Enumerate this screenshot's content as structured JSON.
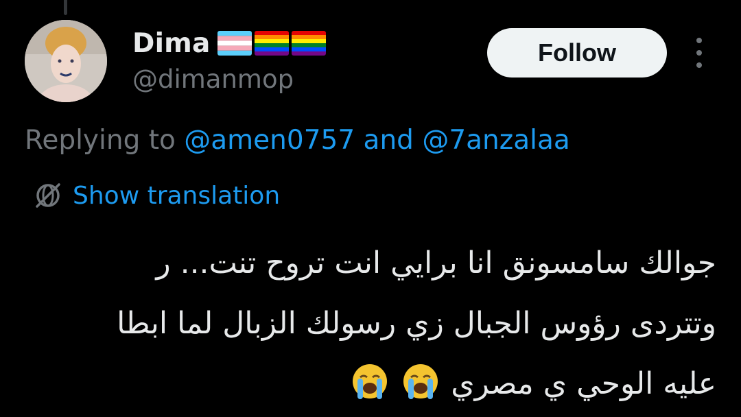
{
  "tweet": {
    "author": {
      "display_name": "Dima",
      "handle": "@dimanmop",
      "flags": [
        "transgender-flag",
        "rainbow-flag",
        "rainbow-flag"
      ]
    },
    "follow_label": "Follow",
    "reply_prefix": "Replying to",
    "reply_mentions": [
      "@amen0757",
      "@7anzalaa"
    ],
    "reply_joiner": "and",
    "translate_label": "Show translation",
    "text_lines": [
      "جوالك سامسونق انا برايي انت تروح تنت... ر",
      "وتتردى رؤوس الجبال زي رسولك الزبال لما ابطا",
      "عليه الوحي ي مصري"
    ],
    "emojis": [
      "loudly-crying-face-emoji",
      "loudly-crying-face-emoji"
    ]
  },
  "colors": {
    "background": "#000000",
    "text_primary": "#e7e9ea",
    "text_secondary": "#71767b",
    "link": "#1d9bf0",
    "button_bg": "#eff3f4",
    "emoji_face": "#f4c430",
    "emoji_tears": "#5ab4f0"
  }
}
